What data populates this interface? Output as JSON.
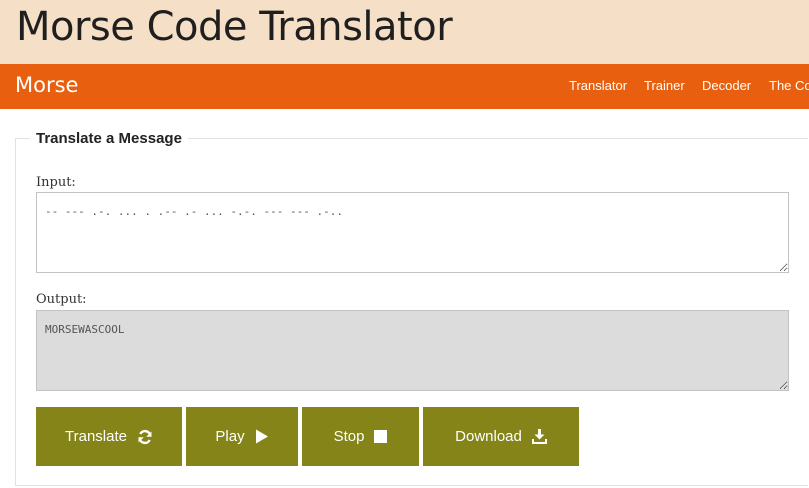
{
  "header": {
    "title": "Morse Code Translator"
  },
  "navbar": {
    "brand": "Morse",
    "items": [
      {
        "label": "Translator"
      },
      {
        "label": "Trainer"
      },
      {
        "label": "Decoder"
      },
      {
        "label": "The Co"
      }
    ]
  },
  "form": {
    "legend": "Translate a Message",
    "input_label": "Input:",
    "input_value": "-- --- .-. ... . .-- .- ... -.-. --- --- .-..",
    "output_label": "Output:",
    "output_value": "MORSEWASCOOL"
  },
  "buttons": {
    "translate": "Translate",
    "play": "Play",
    "stop": "Stop",
    "download": "Download"
  },
  "colors": {
    "header_bg": "#f5dfc6",
    "navbar_bg": "#e8600f",
    "button_bg": "#858419",
    "output_bg": "#dcdcdc"
  },
  "icons": {
    "translate": "refresh-icon",
    "play": "play-icon",
    "stop": "stop-icon",
    "download": "download-icon"
  }
}
